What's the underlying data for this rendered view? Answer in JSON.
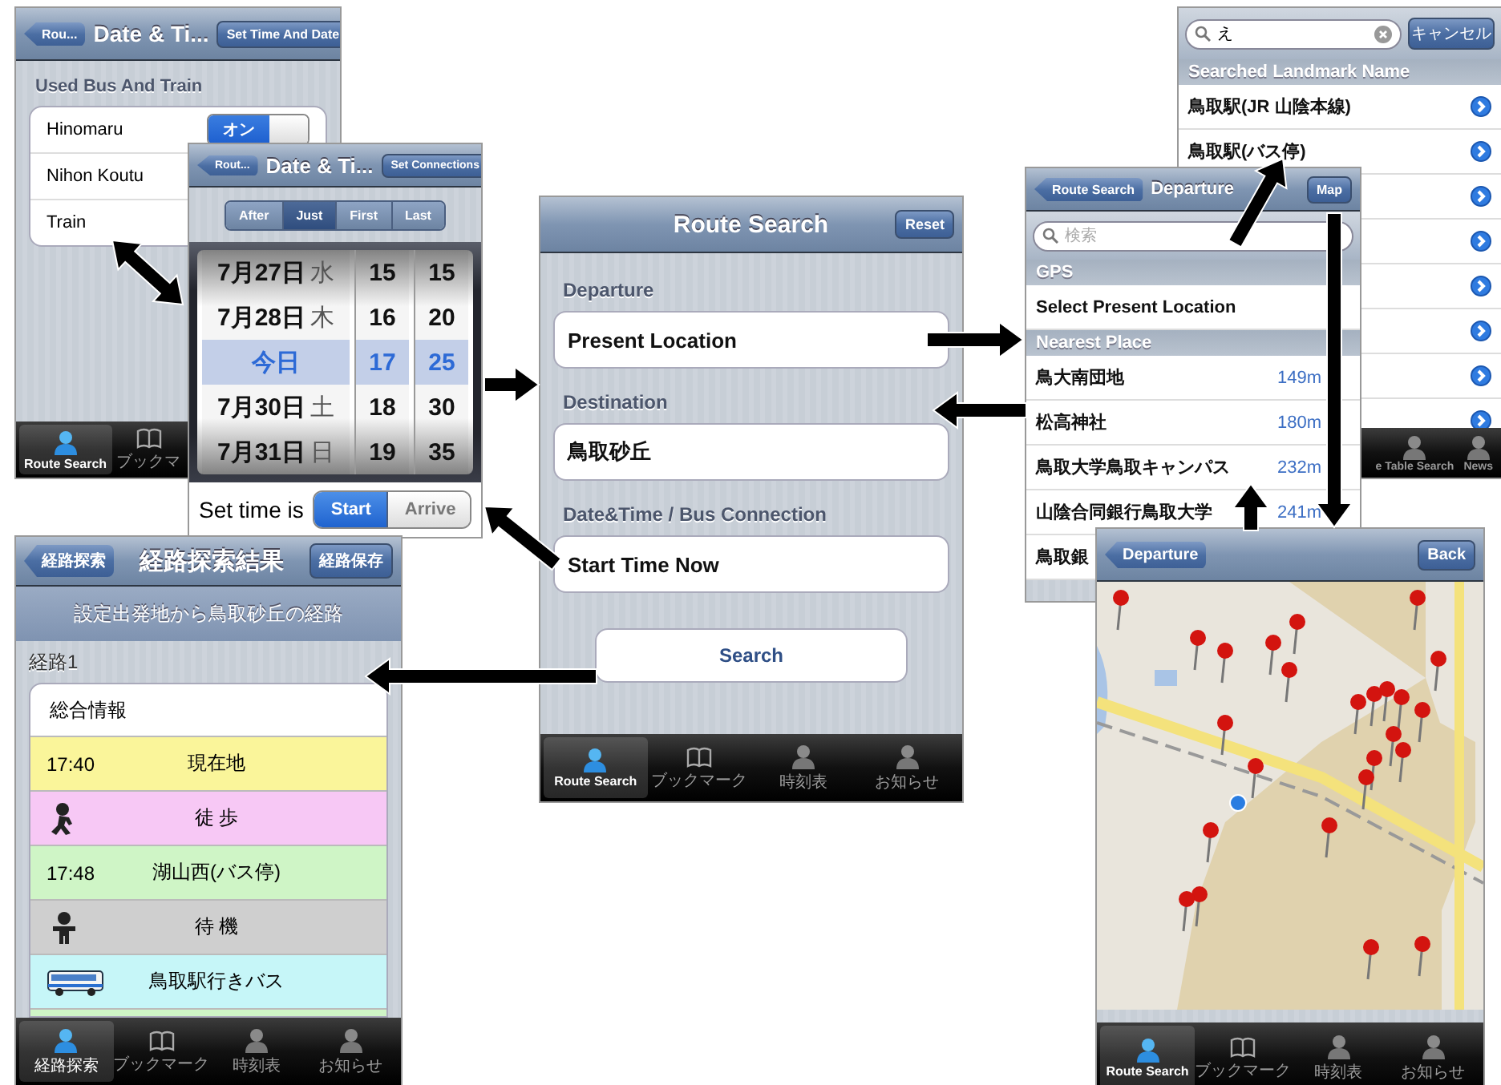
{
  "screens": [
    {
      "kind": "settings",
      "nav": {
        "back": "Rou...",
        "title": "Date & Ti...",
        "action": "Set Time And Date"
      },
      "section": "Used Bus And Train",
      "rows": [
        {
          "name": "Hinomaru",
          "toggle": {
            "label": "オン",
            "on": true
          }
        },
        {
          "name": "Nihon Koutu"
        },
        {
          "name": "Train"
        }
      ],
      "tabs": [
        {
          "label": "Route Search",
          "kind": "search",
          "selected": true
        },
        {
          "label": "ブックマ",
          "kind": "bookmarks",
          "selected": false
        }
      ]
    },
    {
      "kind": "picker",
      "nav": {
        "back": "Rout...",
        "title": "Date & Ti...",
        "action": "Set Connections"
      },
      "segments": [
        {
          "label": "After",
          "selected": false
        },
        {
          "label": "Just",
          "selected": true
        },
        {
          "label": "First",
          "selected": false
        },
        {
          "label": "Last",
          "selected": false
        }
      ],
      "picker_rows": [
        {
          "date": "7月27日",
          "weekday": "水",
          "hour": "15",
          "minute": "15",
          "selected": false
        },
        {
          "date": "7月28日",
          "weekday": "木",
          "hour": "16",
          "minute": "20",
          "selected": false
        },
        {
          "date": "今日",
          "hour": "17",
          "minute": "25",
          "selected": true
        },
        {
          "date": "7月30日",
          "weekday": "土",
          "hour": "18",
          "minute": "30",
          "selected": false
        },
        {
          "date": "7月31日",
          "weekday": "日",
          "hour": "19",
          "minute": "35",
          "selected": false
        }
      ],
      "set_time": {
        "label": "Set time is",
        "options": [
          {
            "label": "Start",
            "selected": true
          },
          {
            "label": "Arrive",
            "selected": false
          }
        ]
      }
    },
    {
      "kind": "results",
      "nav": {
        "back": "経路探索",
        "title": "経路探索結果",
        "action": "経路保存"
      },
      "banner": "設定出発地から鳥取砂丘の経路",
      "route_label": "経路1",
      "summary": "総合情報",
      "steps": [
        {
          "kind": "time",
          "time": "17:40",
          "text": "現在地",
          "color": "#faf59a"
        },
        {
          "kind": "walk",
          "text": "徒 歩",
          "color": "#f7c8f5"
        },
        {
          "kind": "time",
          "time": "17:48",
          "text": "湖山西(バス停)",
          "color": "#cff5c6"
        },
        {
          "kind": "wait",
          "text": "待 機",
          "color": "#cfcfcf"
        },
        {
          "kind": "bus",
          "text": "鳥取駅行きバス",
          "color": "#c6f6f8"
        },
        {
          "kind": "partial",
          "color": "#cff5c6"
        }
      ],
      "tabs": [
        {
          "label": "経路探索",
          "kind": "search",
          "selected": true
        },
        {
          "label": "ブックマーク",
          "kind": "bookmarks",
          "selected": false
        },
        {
          "label": "時刻表",
          "kind": "timetable",
          "selected": false
        },
        {
          "label": "お知らせ",
          "kind": "news",
          "selected": false
        }
      ]
    },
    {
      "kind": "form",
      "nav": {
        "title": "Route Search",
        "action": "Reset"
      },
      "fields": [
        {
          "label": "Departure",
          "value": "Present Location"
        },
        {
          "label": "Destination",
          "value": "鳥取砂丘"
        },
        {
          "label": "Date&Time / Bus Connection",
          "value": "Start Time Now"
        }
      ],
      "search_button": "Search",
      "tabs": [
        {
          "label": "Route Search",
          "kind": "search",
          "selected": true
        },
        {
          "label": "ブックマーク",
          "kind": "bookmarks",
          "selected": false
        },
        {
          "label": "時刻表",
          "kind": "timetable",
          "selected": false
        },
        {
          "label": "お知らせ",
          "kind": "news",
          "selected": false
        }
      ]
    },
    {
      "kind": "landmarks",
      "search": {
        "value": "え"
      },
      "cancel": "キャンセル",
      "header": "Searched Landmark Name",
      "rows": [
        {
          "name": "鳥取駅(JR 山陰本線)",
          "detail_button": true
        },
        {
          "name": "鳥取駅(バス停)",
          "detail_button": true
        },
        {
          "detail_button": true
        },
        {
          "detail_button": true
        },
        {
          "detail_button": true
        },
        {
          "detail_button": true
        },
        {
          "detail_button": true
        },
        {
          "detail_button": true
        }
      ],
      "tabs": [
        {
          "label": "e Table Search",
          "kind": "timetable",
          "selected": false
        },
        {
          "label": "News",
          "kind": "news",
          "selected": false
        }
      ]
    },
    {
      "kind": "places",
      "nav": {
        "back": "Route Search",
        "title": "Departure",
        "action": "Map"
      },
      "search": {
        "placeholder": "検索"
      },
      "sections": [
        {
          "header": "GPS",
          "rows": [
            {
              "name": "Select Present Location"
            }
          ]
        },
        {
          "header": "Nearest Place",
          "rows": [
            {
              "name": "鳥大南団地",
              "distance": "149m"
            },
            {
              "name": "松高神社",
              "distance": "180m"
            },
            {
              "name": "鳥取大学鳥取キャンパス",
              "distance": "232m"
            },
            {
              "name": "山陰合同銀行鳥取大学",
              "distance": "241m"
            },
            {
              "name": "鳥取銀"
            }
          ]
        }
      ]
    },
    {
      "kind": "map",
      "nav": {
        "back": "Departure",
        "action": "Back"
      },
      "tabs": [
        {
          "label": "Route Search",
          "kind": "search",
          "selected": true
        },
        {
          "label": "ブックマーク",
          "kind": "bookmarks",
          "selected": false
        },
        {
          "label": "時刻表",
          "kind": "timetable",
          "selected": false
        },
        {
          "label": "お知らせ",
          "kind": "news",
          "selected": false
        }
      ]
    }
  ]
}
